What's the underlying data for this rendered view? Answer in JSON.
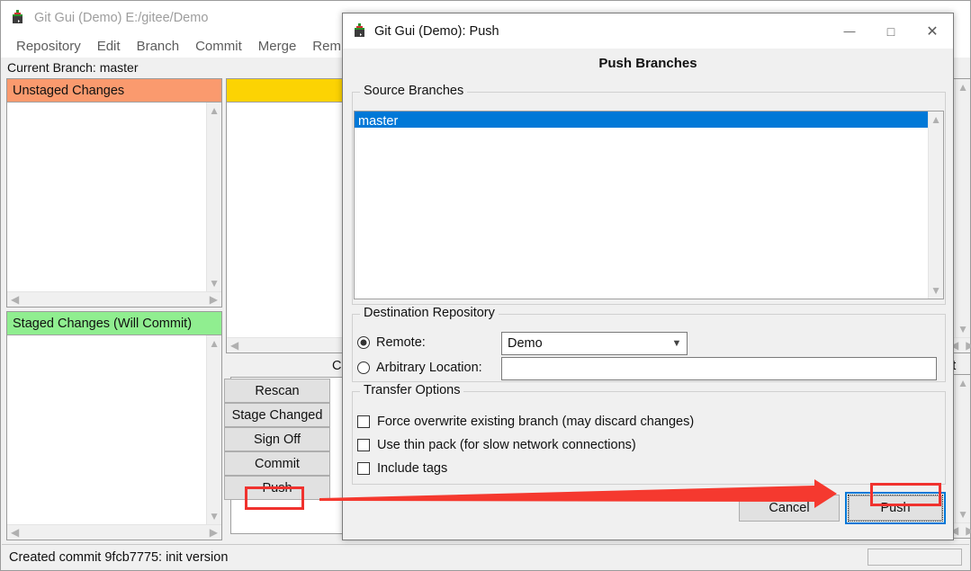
{
  "main_window": {
    "title": "Git Gui (Demo) E:/gitee/Demo",
    "icon": "git-gui-icon",
    "window_controls": [
      {
        "name": "minimize",
        "glyph": "—"
      },
      {
        "name": "maximize",
        "glyph": "□"
      },
      {
        "name": "close",
        "glyph": "✕"
      }
    ],
    "menu": [
      "Repository",
      "Edit",
      "Branch",
      "Commit",
      "Merge",
      "Rem"
    ],
    "current_branch_label": "Current Branch: master",
    "panels": {
      "unstaged": {
        "title": "Unstaged Changes",
        "color": "#fa9a6e",
        "items": []
      },
      "staged": {
        "title": "Staged Changes (Will Commit)",
        "color": "#90ee90",
        "items": []
      },
      "diff": {
        "header_color": "#fcd303",
        "content": ""
      }
    },
    "commit_message_label": "Co",
    "buttons": [
      "Rescan",
      "Stage Changed",
      "Sign Off",
      "Commit",
      "Push"
    ],
    "hidden_button_label": "nit",
    "status": {
      "text": "Created commit 9fcb7775: init version",
      "progress": ""
    }
  },
  "dialog": {
    "title": "Git Gui (Demo): Push",
    "icon": "git-gui-icon",
    "window_controls": [
      {
        "name": "minimize",
        "glyph": "—"
      },
      {
        "name": "maximize",
        "glyph": "□"
      },
      {
        "name": "close",
        "glyph": "✕"
      }
    ],
    "heading": "Push Branches",
    "source_branches": {
      "group_label": "Source Branches",
      "items": [
        "master"
      ],
      "selected": "master",
      "selection_color": "#0078d7"
    },
    "destination": {
      "group_label": "Destination Repository",
      "remote": {
        "label": "Remote:",
        "selected": true,
        "combo_value": "Demo",
        "combo_arrow": "chevron-down-icon"
      },
      "arbitrary": {
        "label": "Arbitrary Location:",
        "selected": false,
        "value": ""
      }
    },
    "transfer_options": {
      "group_label": "Transfer Options",
      "options": [
        {
          "label": "Force overwrite existing branch (may discard changes)",
          "checked": false
        },
        {
          "label": "Use thin pack (for slow network connections)",
          "checked": false
        },
        {
          "label": "Include tags",
          "checked": false
        }
      ]
    },
    "actions": {
      "cancel": "Cancel",
      "push": "Push",
      "push_focused": true
    }
  },
  "annotations": {
    "color": "#f0322e",
    "highlight_boxes": [
      "main-push-button",
      "dialog-push-button"
    ],
    "arrow": {
      "from": "main-push-button",
      "to": "dialog-push-button"
    }
  }
}
